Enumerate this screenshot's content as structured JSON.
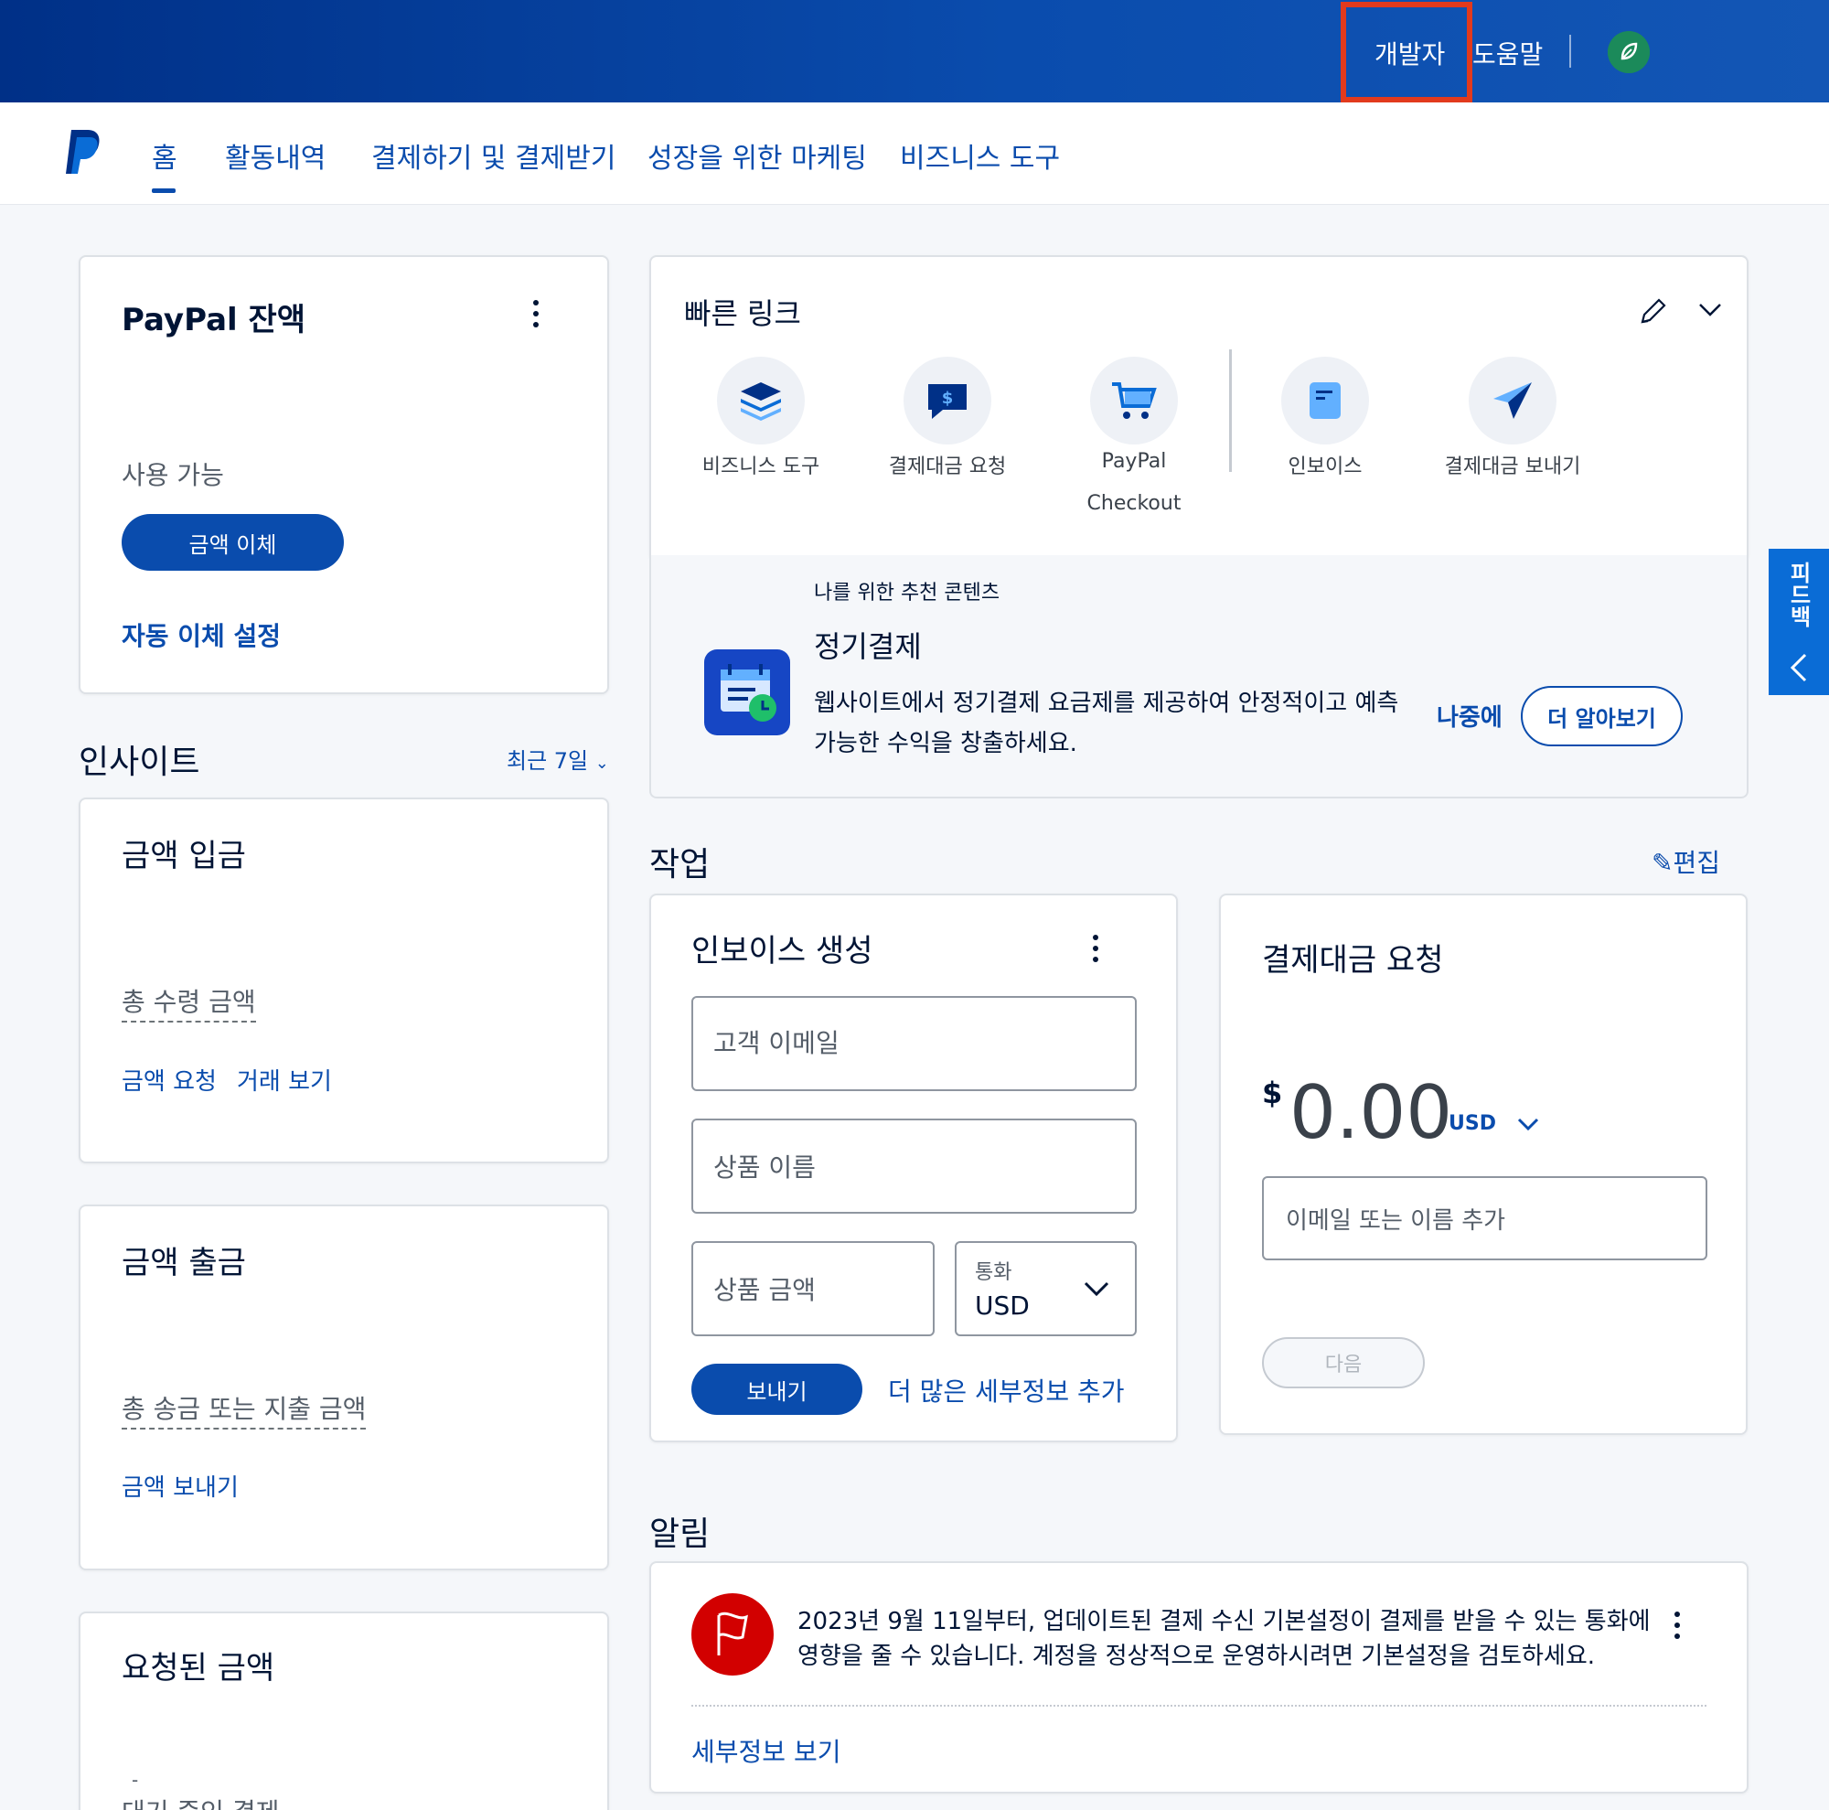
{
  "topbar": {
    "developer": "개발자",
    "help": "도움말"
  },
  "nav": {
    "items": [
      "홈",
      "활동내역",
      "결제하기 및 결제받기",
      "성장을 위한 마케팅",
      "비즈니스 도구"
    ]
  },
  "balance": {
    "title": "PayPal 잔액",
    "available": "사용 가능",
    "transfer_button": "금액 이체",
    "auto_transfer": "자동 이체 설정"
  },
  "insights": {
    "title": "인사이트",
    "range": "최근 7일"
  },
  "deposit": {
    "title": "금액 입금",
    "total": "총 수령 금액",
    "link_request": "금액 요청",
    "link_transactions": "거래 보기"
  },
  "withdraw": {
    "title": "금액 출금",
    "total": "총 송금 또는 지출 금액",
    "link_send": "금액 보내기"
  },
  "requested": {
    "title": "요청된 금액",
    "dash": "-",
    "pending": "대기 중인 결제"
  },
  "quick_links": {
    "title": "빠른 링크",
    "items": [
      {
        "label": "비즈니스 도구",
        "icon": "layers-icon"
      },
      {
        "label": "결제대금 요청",
        "icon": "request-money-icon"
      },
      {
        "label": "PayPal",
        "label2": "Checkout",
        "icon": "cart-icon"
      },
      {
        "label": "인보이스",
        "icon": "invoice-icon"
      },
      {
        "label": "결제대금 보내기",
        "icon": "send-plane-icon"
      }
    ]
  },
  "recommend": {
    "eyebrow": "나를 위한 추천 콘텐츠",
    "title": "정기결제",
    "body1": "웹사이트에서 정기결제 요금제를 제공하여 안정적이고 예측",
    "body2": "가능한 수익을 창출하세요.",
    "later": "나중에",
    "learn_more": "더 알아보기"
  },
  "tasks": {
    "title": "작업",
    "edit": "편집"
  },
  "invoice": {
    "title": "인보이스 생성",
    "email_placeholder": "고객 이메일",
    "product_placeholder": "상품 이름",
    "amount_placeholder": "상품 금액",
    "currency_label": "통화",
    "currency_value": "USD",
    "send_button": "보내기",
    "more_details": "더 많은 세부정보 추가"
  },
  "payment_request": {
    "title": "결제대금 요청",
    "currency_symbol": "$",
    "amount": "0.00",
    "currency": "USD",
    "recipient_placeholder": "이메일 또는 이름 추가",
    "next_button": "다음"
  },
  "alerts": {
    "title": "알림",
    "line1": "2023년 9월 11일부터, 업데이트된 결제 수신 기본설정이 결제를 받을 수 있는 통화에",
    "line2": "영향을 줄 수 있습니다. 계정을 정상적으로 운영하시려면 기본설정을 검토하세요.",
    "details_link": "세부정보 보기"
  },
  "feedback": {
    "label": "피드백"
  },
  "colors": {
    "brand_blue": "#0a4cad",
    "topbar_dark": "#003087",
    "highlight_red": "#e23a1d",
    "alert_red": "#d20000"
  }
}
